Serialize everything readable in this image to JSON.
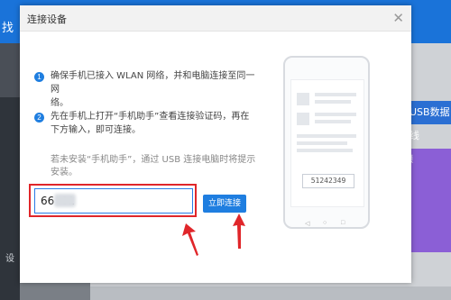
{
  "background": {
    "header_partial": "找",
    "left_partial": "设",
    "usb_badge": "USB数据线",
    "card_partial": "频"
  },
  "dialog": {
    "title": "连接设备",
    "close_icon": "close-icon",
    "steps": [
      {
        "number": "1",
        "text_line1": "确保手机已接入 WLAN 网络，并和电脑连接至同一网",
        "text_line2": "络。"
      },
      {
        "number": "2",
        "text_line1": "先在手机上打开“手机助手”查看连接验证码，再在",
        "text_line2": "下方输入，即可连接。"
      }
    ],
    "hint_line1": "若未安装“手机助手”，通过 USB 连接电脑时将提示",
    "hint_line2": "安装。",
    "code_input_value": "66    .01",
    "connect_button": "立即连接",
    "phone_code": "51242349"
  },
  "colors": {
    "accent": "#1f7ee0",
    "annotation_red": "#e0262a"
  }
}
